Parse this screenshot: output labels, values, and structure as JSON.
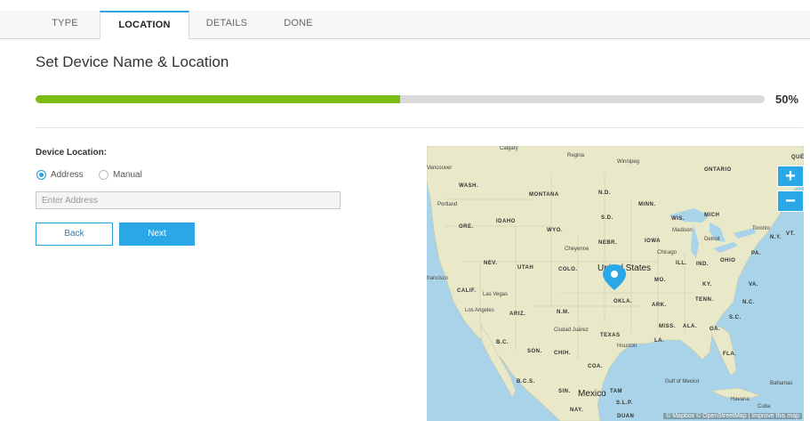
{
  "tabs": [
    {
      "label": "TYPE",
      "active": false
    },
    {
      "label": "LOCATION",
      "active": true
    },
    {
      "label": "DETAILS",
      "active": false
    },
    {
      "label": "DONE",
      "active": false
    }
  ],
  "page": {
    "title": "Set Device Name & Location"
  },
  "progress": {
    "value": 0.5,
    "label": "50%",
    "color": "#7cbb14"
  },
  "form": {
    "location_label": "Device Location:",
    "options": [
      {
        "label": "Address",
        "selected": true
      },
      {
        "label": "Manual",
        "selected": false
      }
    ],
    "address_placeholder": "Enter Address",
    "address_value": "",
    "back_label": "Back",
    "next_label": "Next"
  },
  "map": {
    "zoom_in": "+",
    "zoom_out": "−",
    "attribution": "© Mapbox © OpenStreetMap | Improve this map",
    "country_label": "United States",
    "country_label_2": "Mexico",
    "region_labels": [
      "WASH.",
      "MONTANA",
      "N.D.",
      "MINN.",
      "ONTARIO",
      "ORE.",
      "IDAHO",
      "WYO.",
      "S.D.",
      "WIS.",
      "MICH",
      "NEV.",
      "UTAH",
      "COLO.",
      "NEBR.",
      "IOWA",
      "ILL.",
      "IND.",
      "OHIO",
      "PA.",
      "N.Y.",
      "CALIF.",
      "ARIZ.",
      "N.M.",
      "OKLA.",
      "ARK.",
      "TENN.",
      "KY.",
      "VA.",
      "N.C.",
      "S.C.",
      "MO.",
      "MISS.",
      "ALA.",
      "GA.",
      "TEXAS",
      "LA.",
      "FLA.",
      "SON.",
      "CHIH.",
      "COA.",
      "B.C.",
      "B.C.S.",
      "SIN.",
      "NAY.",
      "S.L.P.",
      "TAM",
      "DUAN",
      "VT.",
      "QUÉ"
    ],
    "city_labels": [
      "Calgary",
      "Regina",
      "Vancouver",
      "Winnipeg",
      "Portland",
      "Cheyenne",
      "Madison",
      "Toronto",
      "Chicago",
      "Detroit",
      "Las Vegas",
      "Los Angeles",
      "Ciudad Juárez",
      "Houston",
      "Havana",
      "Cuba",
      "Bahamas",
      "Gulf of Mexico",
      "francisco"
    ],
    "colors": {
      "water": "#a9d3e8",
      "land": "#e9e8c9",
      "marker": "#2aa7e6"
    }
  }
}
